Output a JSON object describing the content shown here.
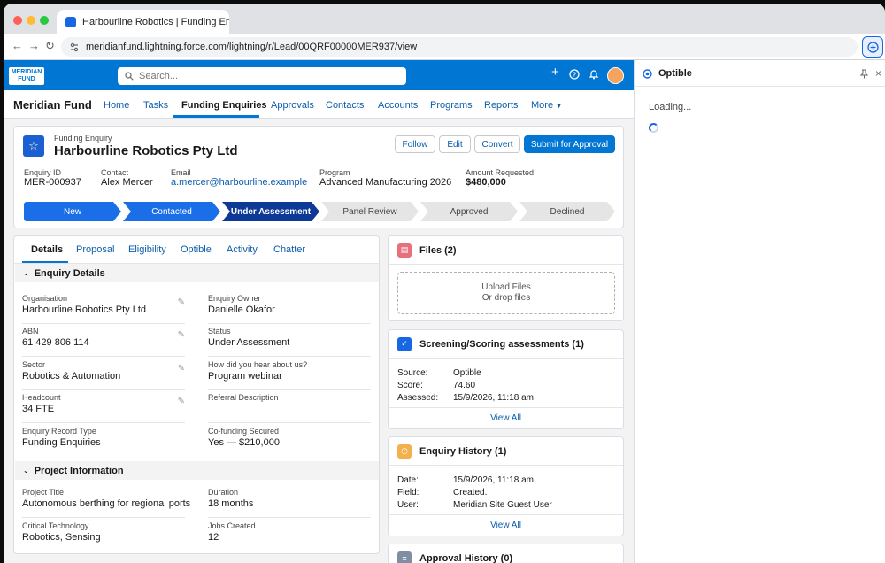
{
  "browser": {
    "tab_title": "Harbourline Robotics | Funding En...",
    "url": "meridianfund.lightning.force.com/lightning/r/Lead/00QRF00000MER937/view",
    "extension_icon": "circle-plus-icon"
  },
  "header": {
    "logo_line1": "MERIDIAN",
    "logo_line2": "FUND",
    "search_placeholder": "Search..."
  },
  "appnav": {
    "app_name": "Meridian Fund",
    "items": [
      "Home",
      "Tasks",
      "Funding Enquiries",
      "Approvals",
      "Contacts",
      "Accounts",
      "Programs",
      "Reports",
      "More"
    ]
  },
  "record": {
    "object_label": "Funding Enquiry",
    "title": "Harbourline Robotics Pty Ltd",
    "buttons": [
      "Follow",
      "Edit",
      "Convert",
      "Submit for Approval"
    ],
    "fields": [
      {
        "label": "Enquiry ID",
        "value": "MER-000937"
      },
      {
        "label": "Contact",
        "value": "Alex Mercer"
      },
      {
        "label": "Email",
        "value": "a.mercer@harbourline.example"
      },
      {
        "label": "Program",
        "value": "Advanced Manufacturing 2026"
      },
      {
        "label": "Amount Requested",
        "value": "$480,000"
      }
    ],
    "stages": [
      "New",
      "Contacted",
      "Under Assessment",
      "Panel Review",
      "Approved",
      "Declined"
    ],
    "current_stage_index": 2
  },
  "details": {
    "tabs": [
      "Details",
      "Proposal",
      "Eligibility",
      "Optible",
      "Activity",
      "Chatter"
    ],
    "section1_title": "Enquiry Details",
    "left_fields": [
      {
        "label": "Organisation",
        "value": "Harbourline Robotics Pty Ltd"
      },
      {
        "label": "ABN",
        "value": "61 429 806 114"
      },
      {
        "label": "Sector",
        "value": "Robotics & Automation"
      },
      {
        "label": "Headcount",
        "value": "34 FTE"
      },
      {
        "label": "Enquiry Record Type",
        "value": "Funding Enquiries"
      }
    ],
    "right_fields": [
      {
        "label": "Enquiry Owner",
        "value": "Danielle Okafor"
      },
      {
        "label": "Status",
        "value": "Under Assessment"
      },
      {
        "label": "How did you hear about us?",
        "value": "Program webinar"
      },
      {
        "label": "Referral Description",
        "value": ""
      },
      {
        "label": "Co-funding Secured",
        "value": "Yes — $210,000"
      }
    ],
    "section2_title": "Project Information",
    "project_left": [
      {
        "label": "Project Title",
        "value": "Autonomous berthing for regional ports"
      },
      {
        "label": "Critical Technology",
        "value": "Robotics, Sensing"
      }
    ],
    "project_right": [
      {
        "label": "Duration",
        "value": "18 months"
      },
      {
        "label": "Jobs Created",
        "value": "12"
      }
    ]
  },
  "files": {
    "title": "Files (2)",
    "upload": "Upload Files",
    "drop": "Or drop files"
  },
  "screening": {
    "title": "Screening/Scoring assessments (1)",
    "rows": [
      {
        "label": "Source:",
        "value": "Optible"
      },
      {
        "label": "Score:",
        "value": "74.60"
      },
      {
        "label": "Assessed:",
        "value": "15/9/2026, 11:18 am"
      }
    ],
    "view_all": "View All"
  },
  "history": {
    "title": "Enquiry History (1)",
    "rows": [
      {
        "label": "Date:",
        "value": "15/9/2026, 11:18 am"
      },
      {
        "label": "Field:",
        "value": "Created."
      },
      {
        "label": "User:",
        "value": "Meridian Site Guest User"
      }
    ],
    "view_all": "View All"
  },
  "approval": {
    "title": "Approval History (0)"
  },
  "sidepanel": {
    "title": "Optible",
    "loading": "Loading..."
  },
  "colors": {
    "brand": "#0176d3",
    "stage_done": "#1a6ee8",
    "stage_current": "#0d3a96"
  }
}
